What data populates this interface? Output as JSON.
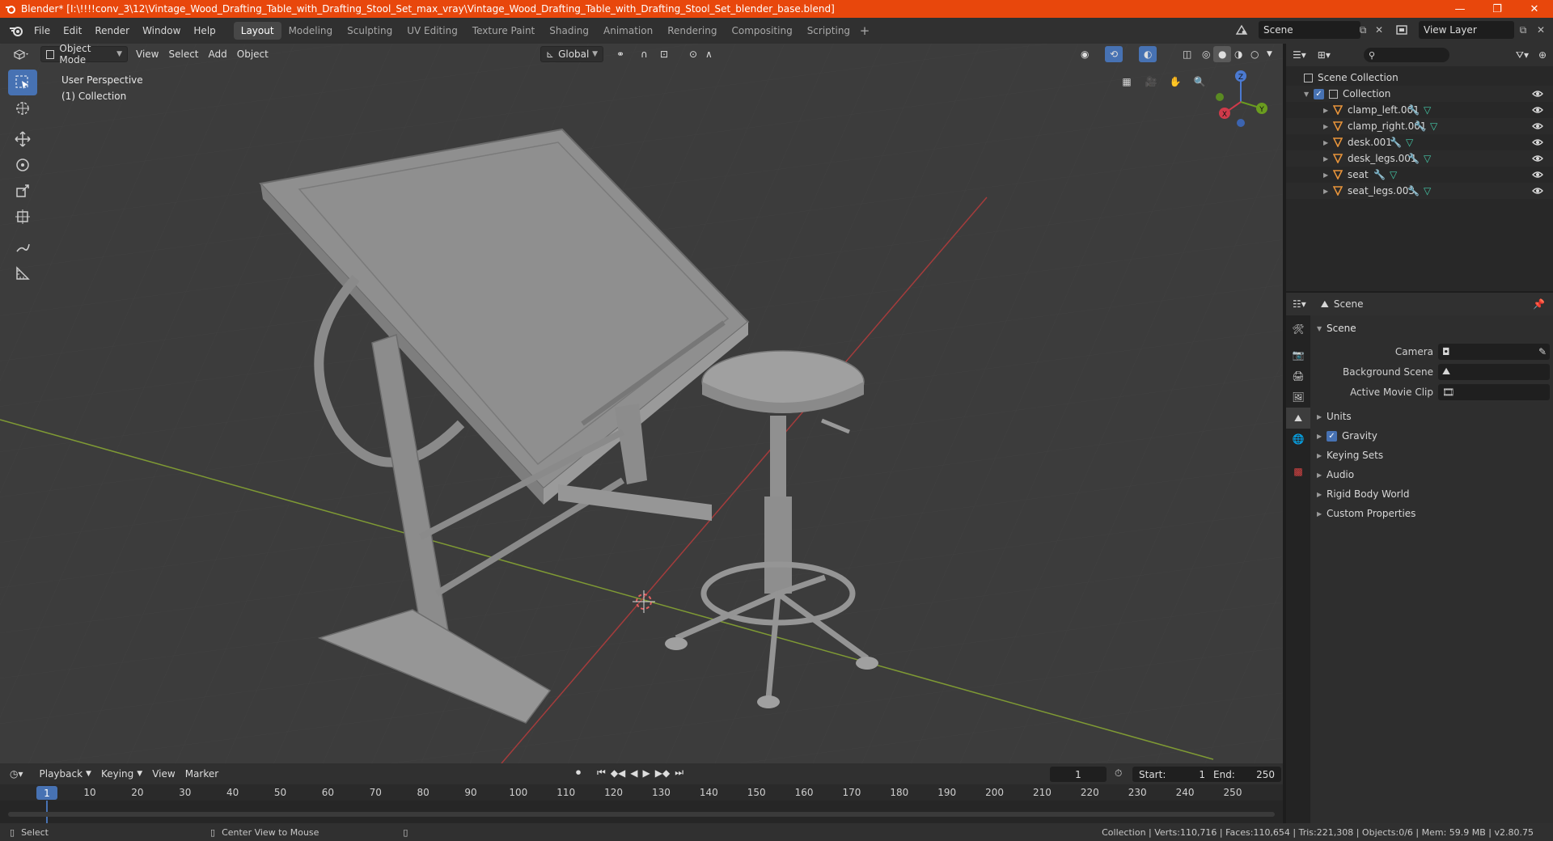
{
  "window": {
    "title": "Blender* [I:\\!!!!conv_3\\12\\Vintage_Wood_Drafting_Table_with_Drafting_Stool_Set_max_vray\\Vintage_Wood_Drafting_Table_with_Drafting_Stool_Set_blender_base.blend]"
  },
  "menu": [
    "File",
    "Edit",
    "Render",
    "Window",
    "Help"
  ],
  "workspaces": [
    "Layout",
    "Modeling",
    "Sculpting",
    "UV Editing",
    "Texture Paint",
    "Shading",
    "Animation",
    "Rendering",
    "Compositing",
    "Scripting"
  ],
  "topright": {
    "scene": "Scene",
    "view_layer": "View Layer"
  },
  "viewport": {
    "mode": "Object Mode",
    "menus": [
      "View",
      "Select",
      "Add",
      "Object"
    ],
    "orientation": "Global",
    "perspective_label": "User Perspective",
    "collection_label": "(1) Collection",
    "gizmo": {
      "x": "X",
      "y": "Y",
      "z": "Z"
    }
  },
  "outliner": {
    "root": "Scene Collection",
    "collection": "Collection",
    "objects": [
      "clamp_left.001",
      "clamp_right.001",
      "desk.001",
      "desk_legs.001",
      "seat",
      "seat_legs.003"
    ]
  },
  "properties": {
    "context": "Scene",
    "section": "Scene",
    "fields": [
      {
        "label": "Camera",
        "value": ""
      },
      {
        "label": "Background Scene",
        "value": ""
      },
      {
        "label": "Active Movie Clip",
        "value": ""
      }
    ],
    "panels": [
      "Units",
      "Gravity",
      "Keying Sets",
      "Audio",
      "Rigid Body World",
      "Custom Properties"
    ]
  },
  "timeline": {
    "menus": [
      "Playback",
      "Keying",
      "View",
      "Marker"
    ],
    "current_frame": "1",
    "start_label": "Start:",
    "start": "1",
    "end_label": "End:",
    "end": "250",
    "ticks": [
      "1",
      "10",
      "20",
      "30",
      "40",
      "50",
      "60",
      "70",
      "80",
      "90",
      "100",
      "110",
      "120",
      "130",
      "140",
      "150",
      "160",
      "170",
      "180",
      "190",
      "200",
      "210",
      "220",
      "230",
      "240",
      "250"
    ]
  },
  "status": {
    "left": "Select",
    "middle": "Center View to Mouse",
    "right": "Collection | Verts:110,716 | Faces:110,654 | Tris:221,308 | Objects:0/6 | Mem: 59.9 MB | v2.80.75"
  },
  "colors": {
    "accent": "#4772b3",
    "title_bar": "#e8470c",
    "object_icon": "#e8943a",
    "modifier_icon": "#5c9fe6",
    "mesh_icon": "#44c9a8"
  }
}
